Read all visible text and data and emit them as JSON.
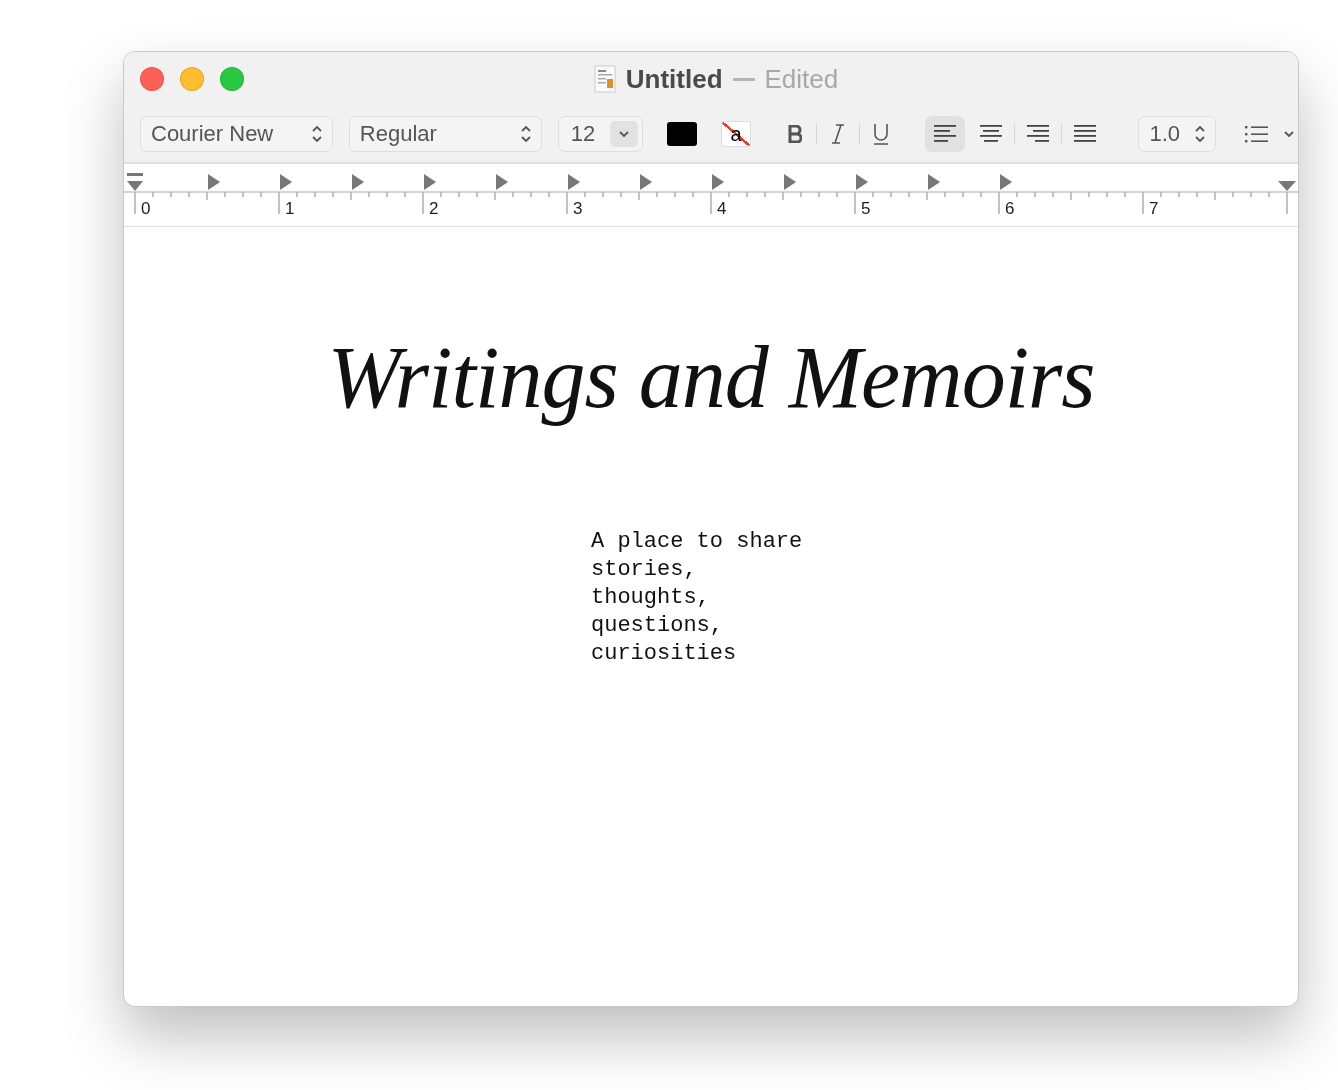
{
  "window": {
    "title": "Untitled",
    "status": "Edited"
  },
  "toolbar": {
    "font_family": "Courier New",
    "font_style": "Regular",
    "font_size": "12",
    "highlight_glyph": "a",
    "alignments": [
      {
        "kind": "left",
        "selected": true
      },
      {
        "kind": "center",
        "selected": false
      },
      {
        "kind": "right",
        "selected": false
      },
      {
        "kind": "justify",
        "selected": false
      }
    ],
    "line_spacing": "1.0"
  },
  "ruler": {
    "numbers": [
      "0",
      "1",
      "2",
      "3",
      "4",
      "5",
      "6",
      "7"
    ]
  },
  "document": {
    "heading": "Writings and Memoirs",
    "lines": [
      "A place to share",
      "stories,",
      "thoughts,",
      "questions,",
      "curiosities"
    ]
  }
}
